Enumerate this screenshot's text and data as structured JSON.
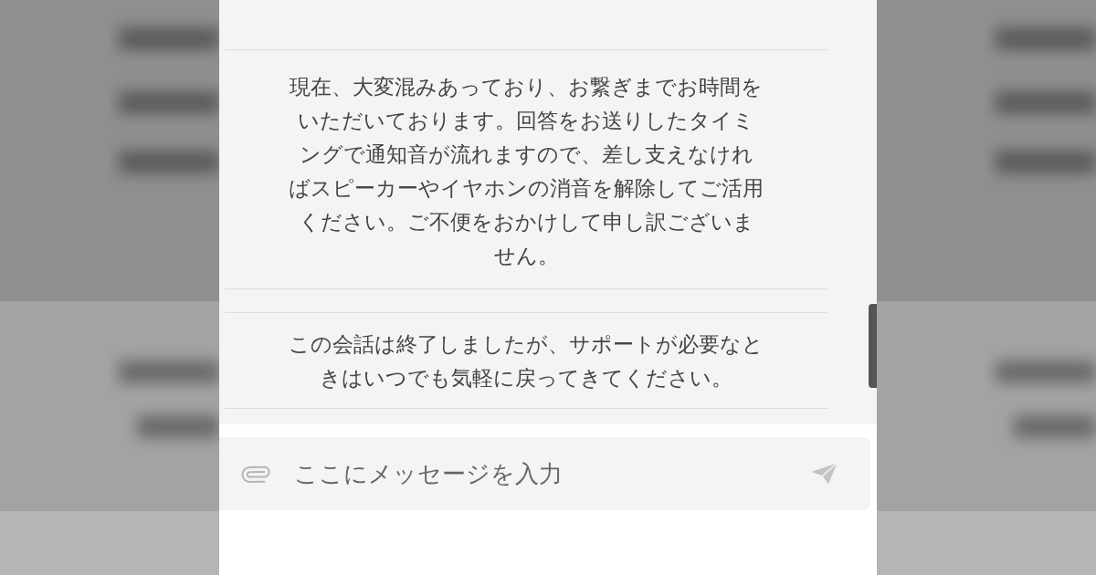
{
  "messages": [
    {
      "text": "現在、大変混みあっており、お繋ぎまでお時間をいただいております。回答をお送りしたタイミングで通知音が流れますので、差し支えなければスピーカーやイヤホンの消音を解除してご活用ください。ご不便をおかけして申し訳ございません。"
    },
    {
      "text": "この会話は終了しましたが、サポートが必要なときはいつでも気軽に戻ってきてください。"
    }
  ],
  "composer": {
    "placeholder": "ここにメッセージを入力"
  }
}
